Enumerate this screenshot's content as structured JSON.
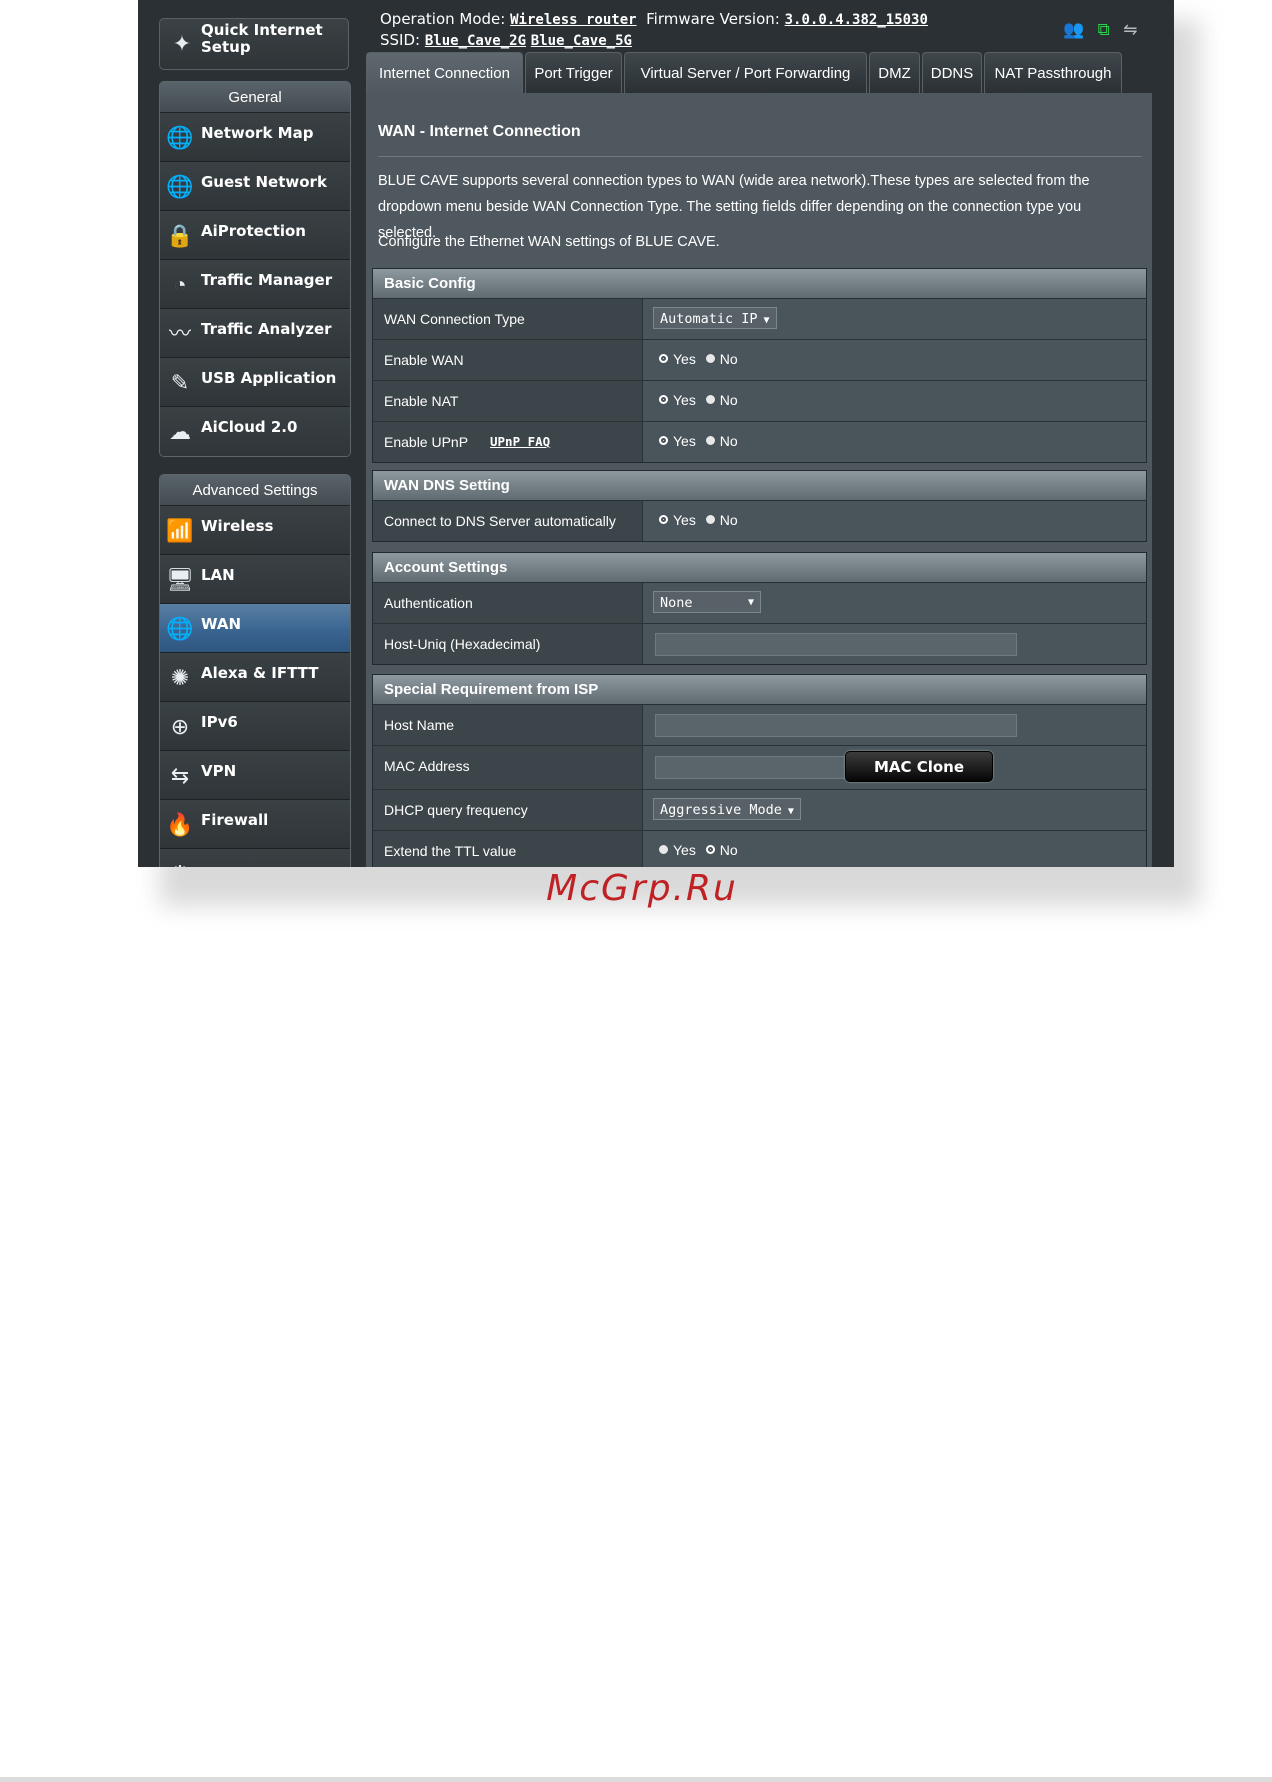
{
  "header": {
    "operation_mode_label": "Operation Mode:",
    "operation_mode_value": "Wireless router",
    "firmware_label": "Firmware Version:",
    "firmware_value": "3.0.0.4.382_15030",
    "ssid_label": "SSID:",
    "ssid_2g": "Blue_Cave_2G",
    "ssid_5g": "Blue_Cave_5G"
  },
  "sidebar": {
    "quick_setup_label": "Quick Internet Setup",
    "general_label": "General",
    "general_items": [
      {
        "label": "Network Map",
        "icon": "globe-icon"
      },
      {
        "label": "Guest Network",
        "icon": "globe-users-icon"
      },
      {
        "label": "AiProtection",
        "icon": "lock-icon"
      },
      {
        "label": "Traffic Manager",
        "icon": "gauge-icon"
      },
      {
        "label": "Traffic Analyzer",
        "icon": "pulse-icon"
      },
      {
        "label": "USB Application",
        "icon": "usb-icon"
      },
      {
        "label": "AiCloud 2.0",
        "icon": "cloud-icon"
      }
    ],
    "advanced_label": "Advanced Settings",
    "advanced_items": [
      {
        "label": "Wireless",
        "icon": "wifi-icon"
      },
      {
        "label": "LAN",
        "icon": "monitor-icon"
      },
      {
        "label": "WAN",
        "icon": "globe-icon"
      },
      {
        "label": "Alexa & IFTTT",
        "icon": "alexa-icon"
      },
      {
        "label": "IPv6",
        "icon": "ipv6-icon"
      },
      {
        "label": "VPN",
        "icon": "vpn-icon"
      },
      {
        "label": "Firewall",
        "icon": "fire-icon"
      }
    ]
  },
  "tabs": [
    "Internet Connection",
    "Port Trigger",
    "Virtual Server / Port Forwarding",
    "DMZ",
    "DDNS",
    "NAT Passthrough"
  ],
  "main": {
    "title": "WAN - Internet Connection",
    "description": "BLUE CAVE supports several connection types to WAN (wide area network).These types are selected from the dropdown menu beside WAN Connection Type. The setting fields differ depending on the connection type you selected.",
    "description2": "Configure the Ethernet WAN settings of BLUE CAVE.",
    "radio_yes": "Yes",
    "radio_no": "No",
    "basic": {
      "title": "Basic Config",
      "wan_type_label": "WAN Connection Type",
      "wan_type_value": "Automatic IP",
      "enable_wan_label": "Enable WAN",
      "enable_nat_label": "Enable NAT",
      "enable_upnp_label": "Enable UPnP",
      "upnp_faq": "UPnP FAQ"
    },
    "dns": {
      "title": "WAN DNS Setting",
      "auto_dns_label": "Connect to DNS Server automatically"
    },
    "account": {
      "title": "Account Settings",
      "auth_label": "Authentication",
      "auth_value": "None",
      "host_uniq_label": "Host-Uniq (Hexadecimal)"
    },
    "isp": {
      "title": "Special Requirement from ISP",
      "host_name_label": "Host Name",
      "mac_label": "MAC Address",
      "mac_clone": "MAC Clone",
      "dhcp_label": "DHCP query frequency",
      "dhcp_value": "Aggressive Mode",
      "ttl_label": "Extend the TTL value"
    }
  },
  "watermark": "McGrp.Ru",
  "colors": {
    "active_blue": "#3b6591",
    "panel": "#4e585e",
    "watermark": "#c02124"
  }
}
